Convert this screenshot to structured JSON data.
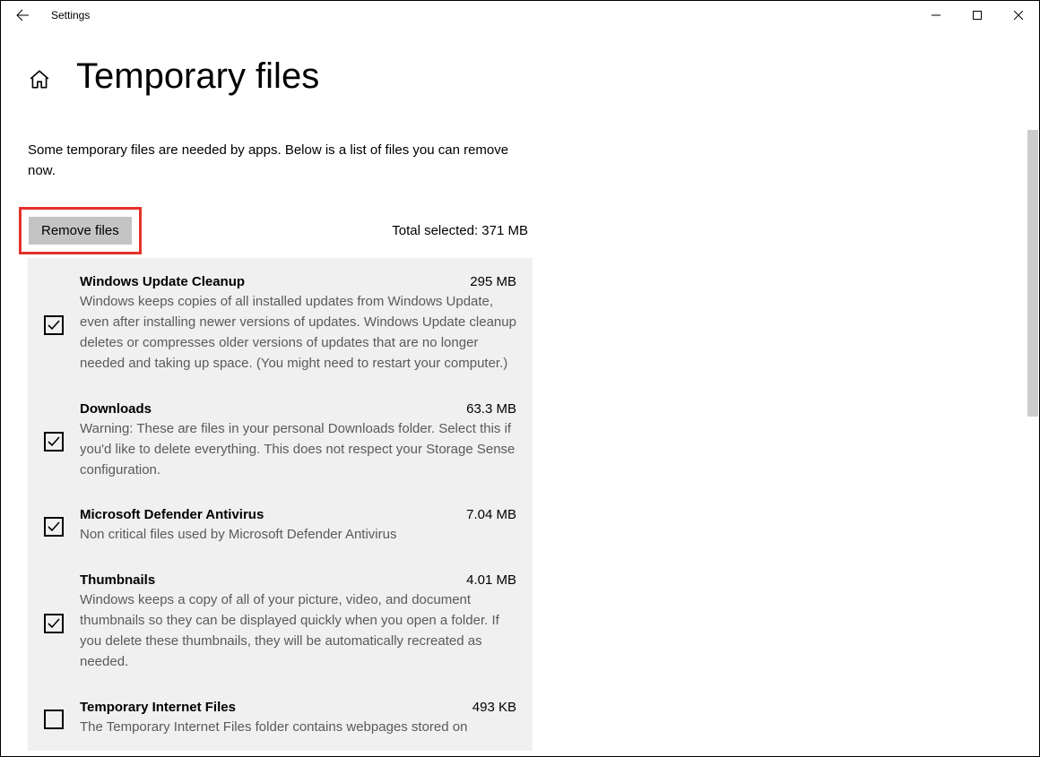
{
  "app": {
    "title": "Settings"
  },
  "page": {
    "title": "Temporary files",
    "intro": "Some temporary files are needed by apps. Below is a list of files you can remove now."
  },
  "action": {
    "remove_label": "Remove files",
    "total_selected": "Total selected: 371 MB"
  },
  "items": [
    {
      "title": "Windows Update Cleanup",
      "size": "295 MB",
      "desc": "Windows keeps copies of all installed updates from Windows Update, even after installing newer versions of updates. Windows Update cleanup deletes or compresses older versions of updates that are no longer needed and taking up space. (You might need to restart your computer.)",
      "checked": true
    },
    {
      "title": "Downloads",
      "size": "63.3 MB",
      "desc": "Warning: These are files in your personal Downloads folder. Select this if you'd like to delete everything. This does not respect your Storage Sense configuration.",
      "checked": true
    },
    {
      "title": "Microsoft Defender Antivirus",
      "size": "7.04 MB",
      "desc": "Non critical files used by Microsoft Defender Antivirus",
      "checked": true
    },
    {
      "title": "Thumbnails",
      "size": "4.01 MB",
      "desc": "Windows keeps a copy of all of your picture, video, and document thumbnails so they can be displayed quickly when you open a folder. If you delete these thumbnails, they will be automatically recreated as needed.",
      "checked": true
    },
    {
      "title": "Temporary Internet Files",
      "size": "493 KB",
      "desc": "The Temporary Internet Files folder contains webpages stored on",
      "checked": false
    }
  ]
}
